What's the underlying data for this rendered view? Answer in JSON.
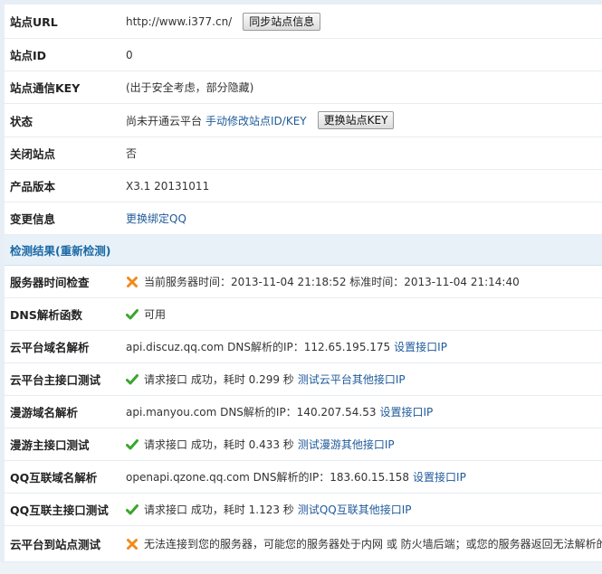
{
  "site_info": {
    "url": {
      "label": "站点URL",
      "value": "http://www.i377.cn/",
      "button": "同步站点信息"
    },
    "site_id": {
      "label": "站点ID",
      "value": "0"
    },
    "key": {
      "label": "站点通信KEY",
      "value": "(出于安全考虑，部分隐藏)"
    },
    "status": {
      "label": "状态",
      "value": "尚未开通云平台",
      "link": "手动修改站点ID/KEY",
      "button": "更换站点KEY"
    },
    "closed": {
      "label": "关闭站点",
      "value": "否"
    },
    "version": {
      "label": "产品版本",
      "value": "X3.1 20131011"
    },
    "change": {
      "label": "变更信息",
      "link": "更换绑定QQ"
    }
  },
  "checks": {
    "header": "检测结果(重新检测)",
    "rows": [
      {
        "label": "服务器时间检查",
        "icon": "cross-icon",
        "text": "当前服务器时间：2013-11-04 21:18:52 标准时间：2013-11-04 21:14:40",
        "link": ""
      },
      {
        "label": "DNS解析函数",
        "icon": "check-icon",
        "text": "可用",
        "link": ""
      },
      {
        "label": "云平台域名解析",
        "icon": "",
        "text": "api.discuz.qq.com DNS解析的IP：112.65.195.175",
        "link": "设置接口IP"
      },
      {
        "label": "云平台主接口测试",
        "icon": "check-icon",
        "text": "请求接口 成功，耗时 0.299 秒",
        "link": "测试云平台其他接口IP"
      },
      {
        "label": "漫游域名解析",
        "icon": "",
        "text": "api.manyou.com DNS解析的IP：140.207.54.53",
        "link": "设置接口IP"
      },
      {
        "label": "漫游主接口测试",
        "icon": "check-icon",
        "text": "请求接口 成功，耗时 0.433 秒",
        "link": "测试漫游其他接口IP"
      },
      {
        "label": "QQ互联域名解析",
        "icon": "",
        "text": "openapi.qzone.qq.com DNS解析的IP：183.60.15.158",
        "link": "设置接口IP"
      },
      {
        "label": "QQ互联主接口测试",
        "icon": "check-icon",
        "text": "请求接口 成功，耗时 1.123 秒",
        "link": "测试QQ互联其他接口IP"
      },
      {
        "label": "云平台到站点测试",
        "icon": "cross-icon",
        "text": "无法连接到您的服务器，可能您的服务器处于内网 或 防火墙后端；或您的服务器返回无法解析的",
        "link": ""
      }
    ]
  },
  "colors": {
    "link": "#1f5a9a",
    "section_title": "#1b69a5",
    "check": "#3aa62d",
    "cross": "#f08a1a"
  }
}
